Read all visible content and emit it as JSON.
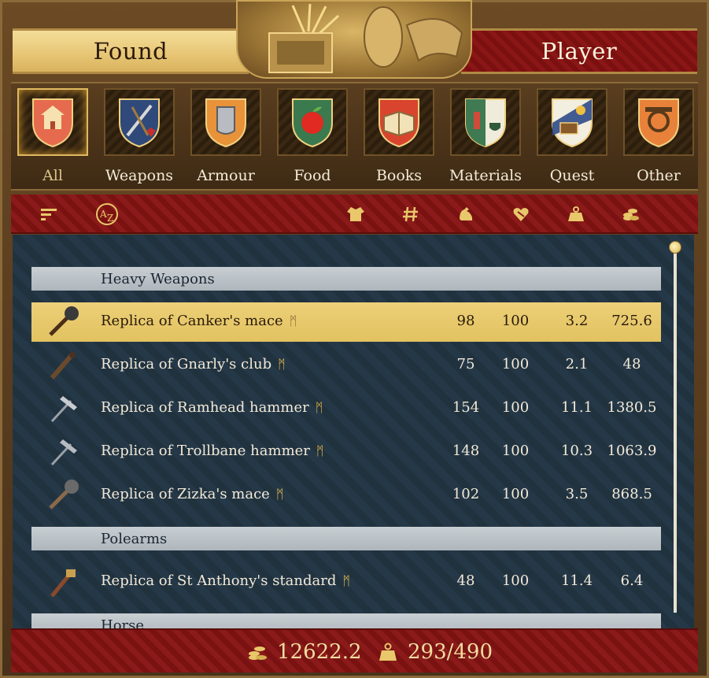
{
  "tabs": {
    "found": "Found",
    "player": "Player"
  },
  "categories": [
    {
      "label": "All",
      "icon": "house-key-icon",
      "active": true
    },
    {
      "label": "Weapons",
      "icon": "weapons-icon",
      "active": false
    },
    {
      "label": "Armour",
      "icon": "armour-icon",
      "active": false
    },
    {
      "label": "Food",
      "icon": "apple-icon",
      "active": false
    },
    {
      "label": "Books",
      "icon": "book-icon",
      "active": false
    },
    {
      "label": "Materials",
      "icon": "materials-icon",
      "active": false
    },
    {
      "label": "Quest",
      "icon": "chest-icon",
      "active": false
    },
    {
      "label": "Other",
      "icon": "tools-icon",
      "active": false
    }
  ],
  "sort_icons": [
    "filter-icon",
    "az-sort-icon",
    "clothing-icon",
    "count-icon",
    "strength-icon",
    "condition-icon",
    "weight-icon",
    "price-icon"
  ],
  "sections": [
    {
      "title": "Heavy Weapons",
      "items": [
        {
          "name": "Replica of Canker's mace",
          "v1": "98",
          "v2": "100",
          "v3": "3.2",
          "v4": "725.6",
          "selected": true
        },
        {
          "name": "Replica of Gnarly's club",
          "v1": "75",
          "v2": "100",
          "v3": "2.1",
          "v4": "48",
          "selected": false
        },
        {
          "name": "Replica of Ramhead hammer",
          "v1": "154",
          "v2": "100",
          "v3": "11.1",
          "v4": "1380.5",
          "selected": false
        },
        {
          "name": "Replica of Trollbane hammer",
          "v1": "148",
          "v2": "100",
          "v3": "10.3",
          "v4": "1063.9",
          "selected": false
        },
        {
          "name": "Replica of Zizka's mace",
          "v1": "102",
          "v2": "100",
          "v3": "3.5",
          "v4": "868.5",
          "selected": false
        }
      ]
    },
    {
      "title": "Polearms",
      "items": [
        {
          "name": "Replica of St Anthony's standard",
          "v1": "48",
          "v2": "100",
          "v3": "11.4",
          "v4": "6.4",
          "selected": false
        }
      ]
    },
    {
      "title": "Horse",
      "items": []
    }
  ],
  "footer": {
    "money": "12622.2",
    "weight": "293/490"
  },
  "colors": {
    "gold": "#e2c260",
    "red": "#8b1a1a",
    "panel": "#253848"
  }
}
